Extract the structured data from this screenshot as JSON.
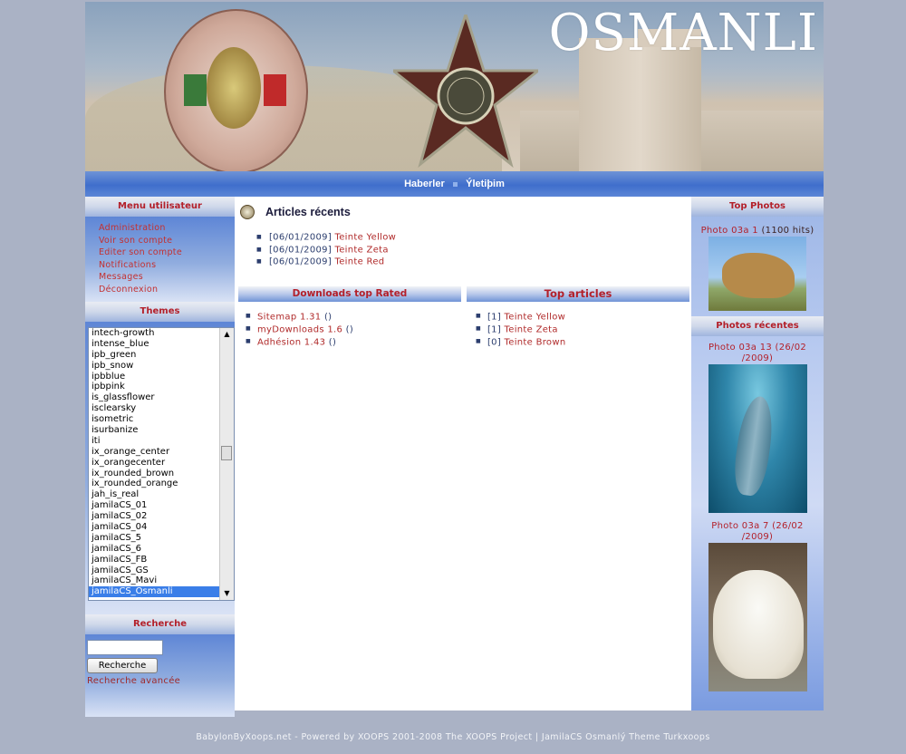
{
  "header": {
    "brand": "OSMANLI"
  },
  "nav": {
    "items": [
      "Haberler",
      "Ýletiþim"
    ]
  },
  "left": {
    "user_menu": {
      "title": "Menu utilisateur",
      "items": [
        "Administration",
        "Voir son compte",
        "Editer son compte",
        "Notifications",
        "Messages",
        "Déconnexion"
      ]
    },
    "themes": {
      "title": "Themes",
      "options": [
        "intech-growth",
        "intense_blue",
        "ipb_green",
        "ipb_snow",
        "ipbblue",
        "ipbpink",
        "is_glassflower",
        "isclearsky",
        "isometric",
        "isurbanize",
        "iti",
        "ix_orange_center",
        "ix_orangecenter",
        "ix_rounded_brown",
        "ix_rounded_orange",
        "jah_is_real",
        "jamilaCS_01",
        "jamilaCS_02",
        "jamilaCS_04",
        "jamilaCS_5",
        "jamilaCS_6",
        "jamilaCS_FB",
        "jamilaCS_GS",
        "jamilaCS_Mavi",
        "jamilaCS_Osmanli"
      ],
      "selected": "jamilaCS_Osmanli"
    },
    "search": {
      "title": "Recherche",
      "input_value": "",
      "button_label": "Recherche",
      "advanced_link": "Recherche avancée"
    }
  },
  "center": {
    "recent_articles": {
      "title": "Articles récents",
      "items": [
        {
          "date": "[06/01/2009]",
          "title": "Teinte Yellow"
        },
        {
          "date": "[06/01/2009]",
          "title": "Teinte Zeta"
        },
        {
          "date": "[06/01/2009]",
          "title": "Teinte Red"
        }
      ]
    },
    "downloads": {
      "title": "Downloads top Rated",
      "items": [
        {
          "name": "Sitemap 1.31",
          "extra": "()"
        },
        {
          "name": "myDownloads 1.6",
          "extra": "()"
        },
        {
          "name": "Adhésion 1.43",
          "extra": "()"
        }
      ]
    },
    "top_articles": {
      "title": "Top articles",
      "items": [
        {
          "count": "[1]",
          "title": "Teinte Yellow"
        },
        {
          "count": "[1]",
          "title": "Teinte Zeta"
        },
        {
          "count": "[0]",
          "title": "Teinte Brown"
        }
      ]
    }
  },
  "right": {
    "top_photos": {
      "title": "Top Photos",
      "caption": "Photo 03a 1",
      "hits": "(1100 hits)"
    },
    "recent_photos": {
      "title": "Photos récentes",
      "items": [
        {
          "caption": "Photo 03a 13",
          "date": "(26/02 /2009)"
        },
        {
          "caption": "Photo 03a 7",
          "date": "(26/02 /2009)"
        }
      ]
    }
  },
  "footer": {
    "text": "BabylonByXoops.net - Powered by XOOPS 2001-2008 The XOOPS Project  |  JamilaCS Osmanlý Theme Turkxoops"
  }
}
